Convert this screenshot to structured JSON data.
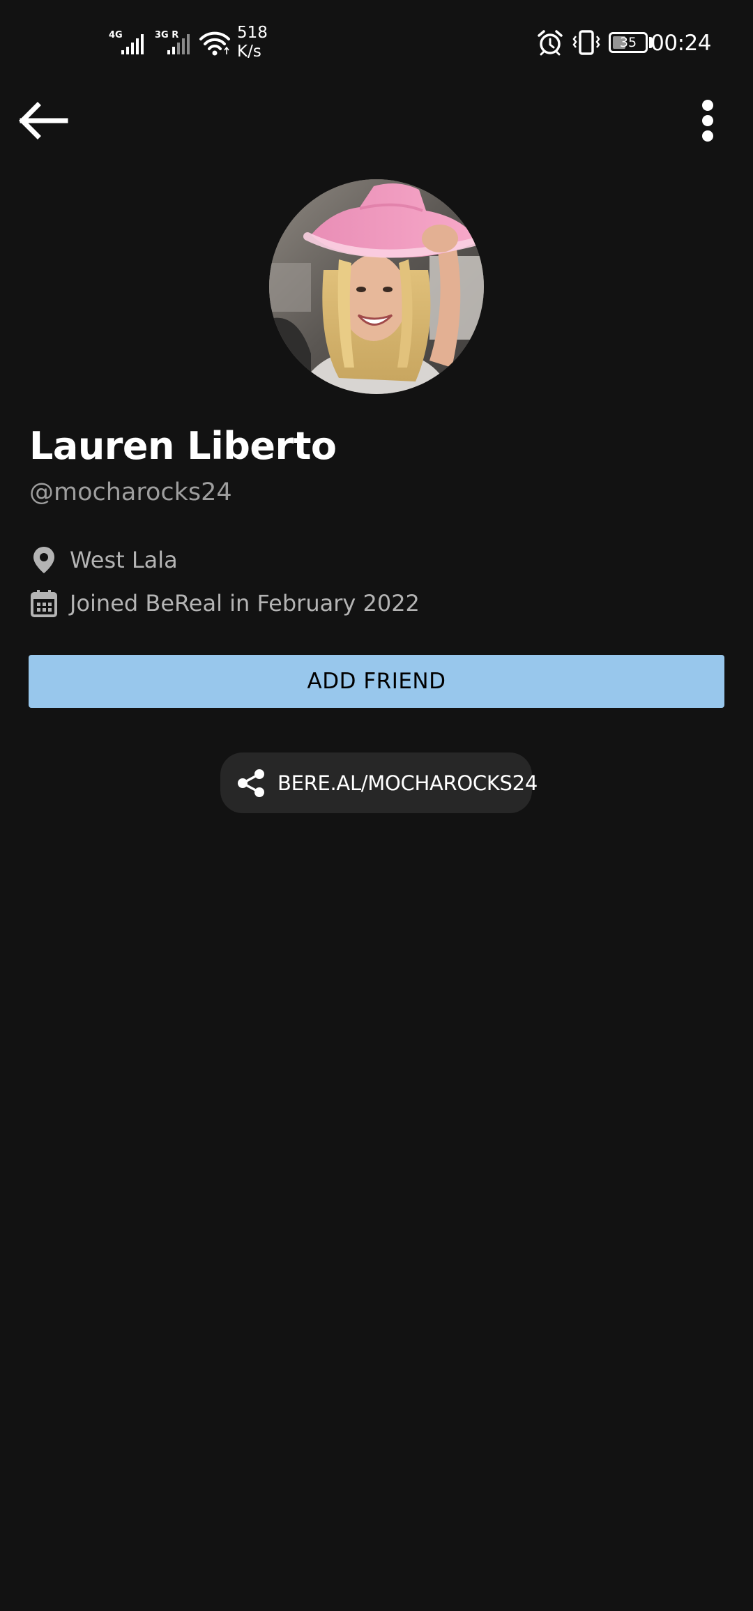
{
  "status_bar": {
    "network_1": "4G",
    "network_2": "3G R",
    "net_speed_value": "518",
    "net_speed_unit": "K/s",
    "battery_level": "35",
    "time": "00:24",
    "icons": [
      "signal-4g-icon",
      "signal-3g-roaming-icon",
      "wifi-icon",
      "alarm-icon",
      "vibrate-icon",
      "battery-icon"
    ]
  },
  "nav": {
    "back_icon": "arrow-left-icon",
    "more_icon": "more-vertical-icon"
  },
  "profile": {
    "name": "Lauren Liberto",
    "handle": "@mocharocks24",
    "location": "West Lala",
    "joined": "Joined BeReal in February 2022"
  },
  "actions": {
    "add_friend_label": "ADD FRIEND",
    "share_link": "BERE.AL/MOCHAROCKS24"
  },
  "colors": {
    "background": "#121212",
    "add_friend_bg": "#98c7ec",
    "pill_bg": "#272727",
    "secondary_text": "#9e9e9e"
  }
}
